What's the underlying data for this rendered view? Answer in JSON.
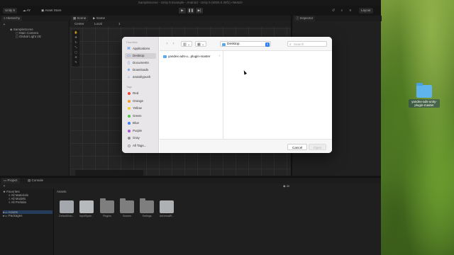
{
  "window": {
    "title": "SampleScene - Unity 6 Example - Android - Unity 6 (6000.0.39f1) <Metal>"
  },
  "toolbar": {
    "unity_label": "Unity 6",
    "account_label": "AY",
    "asset_store_label": "Asset Store",
    "layout_label": "Layout"
  },
  "tabs": {
    "hierarchy": "Hierarchy",
    "scene": "Scene",
    "game": "Game",
    "inspector": "Inspector",
    "project": "Project",
    "console": "Console"
  },
  "scene_toolbar": {
    "pivot": "Center",
    "space": "Local",
    "snap": "1"
  },
  "hierarchy": {
    "items": [
      {
        "label": "SampleScene"
      },
      {
        "label": "Main Camera"
      },
      {
        "label": "Global Light 2D"
      }
    ]
  },
  "project": {
    "tree": [
      {
        "label": "Favorites"
      },
      {
        "label": "All Materials"
      },
      {
        "label": "All Models"
      },
      {
        "label": "All Prefabs"
      },
      {
        "label": "Assets"
      },
      {
        "label": "Packages"
      }
    ],
    "breadcrumb": "Assets",
    "badge_count": "30",
    "assets": [
      {
        "label": "DefaultVolu...",
        "kind": "settings"
      },
      {
        "label": "InputSyste...",
        "kind": "book"
      },
      {
        "label": "Plugins",
        "kind": "folder"
      },
      {
        "label": "Scenes",
        "kind": "folder"
      },
      {
        "label": "Settings",
        "kind": "folder"
      },
      {
        "label": "UniversalR...",
        "kind": "settings"
      }
    ]
  },
  "dialog": {
    "sidebar": {
      "favorites_header": "Favorites",
      "favorites": [
        {
          "label": "Applications",
          "icon": "applications-icon"
        },
        {
          "label": "Desktop",
          "icon": "desktop-icon",
          "selected": true
        },
        {
          "label": "Documents",
          "icon": "document-icon"
        },
        {
          "label": "Downloads",
          "icon": "download-icon"
        },
        {
          "label": "anatoliypush",
          "icon": "home-icon"
        }
      ],
      "tags_header": "Tags",
      "tags": [
        {
          "label": "Red",
          "color": "#f1473d"
        },
        {
          "label": "Orange",
          "color": "#f79a2e"
        },
        {
          "label": "Yellow",
          "color": "#f5cf2e"
        },
        {
          "label": "Green",
          "color": "#53c64a"
        },
        {
          "label": "Blue",
          "color": "#3a82f6"
        },
        {
          "label": "Purple",
          "color": "#a857d6"
        },
        {
          "label": "Gray",
          "color": "#8e8e93"
        },
        {
          "label": "All Tags...",
          "color": ""
        }
      ]
    },
    "location": "Desktop",
    "search_placeholder": "Search",
    "files": [
      {
        "name": "yandex-ads-u...plugin-master"
      }
    ],
    "cancel_label": "Cancel",
    "open_label": "Open"
  },
  "desktop": {
    "folder_label_line1": "yandex-ads-unity-",
    "folder_label_line2": "plugin-master"
  }
}
